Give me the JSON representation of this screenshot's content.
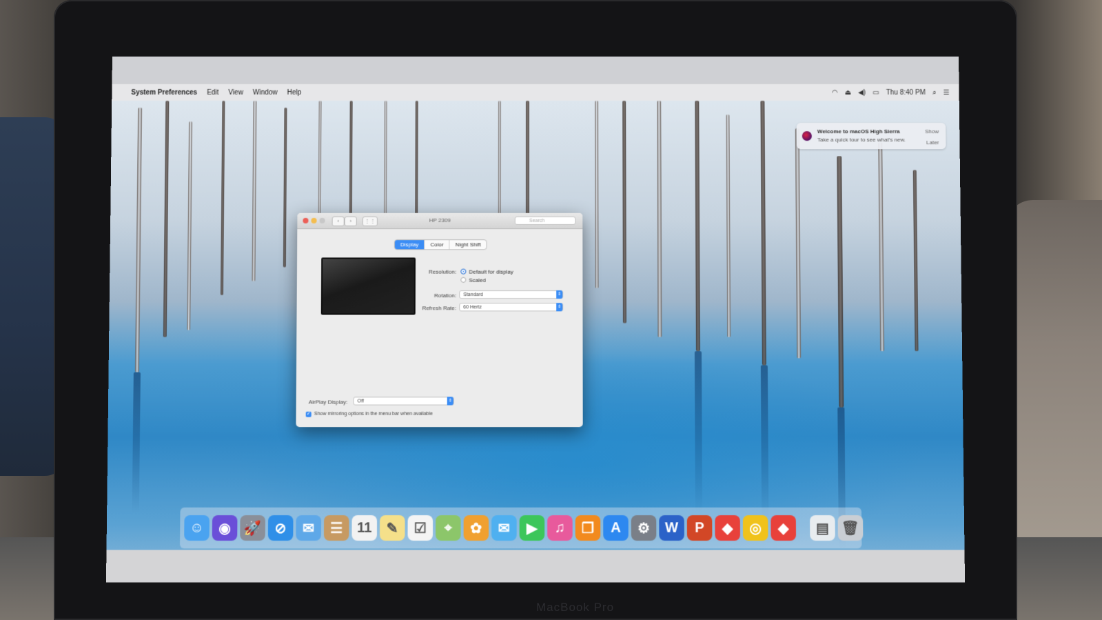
{
  "menubar": {
    "apple_icon": "",
    "app_name": "System Preferences",
    "menus": [
      "Edit",
      "View",
      "Window",
      "Help"
    ],
    "clock": "Thu 8:40 PM",
    "status_icons": [
      "wifi-icon",
      "volume-icon",
      "battery-icon",
      "search-icon",
      "list-icon"
    ]
  },
  "notification": {
    "title": "Welcome to macOS High Sierra",
    "body": "Take a quick tour to see what's new.",
    "show_label": "Show",
    "later_label": "Later"
  },
  "window": {
    "title": "HP 2309",
    "search_placeholder": "Search",
    "tabs": [
      "Display",
      "Color",
      "Night Shift"
    ],
    "active_tab": "Display",
    "resolution_label": "Resolution:",
    "resolution_options": [
      "Default for display",
      "Scaled"
    ],
    "resolution_selected": "Default for display",
    "rotation_label": "Rotation:",
    "rotation_value": "Standard",
    "refresh_label": "Refresh Rate:",
    "refresh_value": "60 Hertz",
    "airplay_label": "AirPlay Display:",
    "airplay_value": "Off",
    "mirroring_label": "Show mirroring options in the menu bar when available",
    "mirroring_checked": true
  },
  "dock": {
    "items": [
      {
        "name": "finder-icon",
        "glyph": "☺",
        "color": "#4aa3f0"
      },
      {
        "name": "siri-icon",
        "glyph": "◉",
        "color": "#6a4fd8"
      },
      {
        "name": "launchpad-icon",
        "glyph": "🚀",
        "color": "#8a8f99"
      },
      {
        "name": "safari-icon",
        "glyph": "⊘",
        "color": "#2f8fe8"
      },
      {
        "name": "mail-icon",
        "glyph": "✉",
        "color": "#5ea8e8"
      },
      {
        "name": "contacts-icon",
        "glyph": "☰",
        "color": "#c79a62"
      },
      {
        "name": "calendar-icon",
        "glyph": "11",
        "color": "#f2f2f2"
      },
      {
        "name": "notes-icon",
        "glyph": "✎",
        "color": "#f5e08a"
      },
      {
        "name": "reminders-icon",
        "glyph": "☑",
        "color": "#f4f4f4"
      },
      {
        "name": "maps-icon",
        "glyph": "⌖",
        "color": "#8cc66a"
      },
      {
        "name": "photos-icon",
        "glyph": "✿",
        "color": "#f0a030"
      },
      {
        "name": "messages-icon",
        "glyph": "✉",
        "color": "#4fb0f0"
      },
      {
        "name": "facetime-icon",
        "glyph": "▶",
        "color": "#3cc65a"
      },
      {
        "name": "itunes-icon",
        "glyph": "♫",
        "color": "#e85a9c"
      },
      {
        "name": "ibooks-icon",
        "glyph": "❒",
        "color": "#f28a1e"
      },
      {
        "name": "app-store-icon",
        "glyph": "A",
        "color": "#2d88f0"
      },
      {
        "name": "system-preferences-icon",
        "glyph": "⚙",
        "color": "#7a7f88"
      },
      {
        "name": "word-icon",
        "glyph": "W",
        "color": "#2b62c8"
      },
      {
        "name": "powerpoint-icon",
        "glyph": "P",
        "color": "#d24726"
      },
      {
        "name": "anydesk-icon",
        "glyph": "◆",
        "color": "#e8413b"
      },
      {
        "name": "chrome-icon",
        "glyph": "◎",
        "color": "#f0c21b"
      },
      {
        "name": "anydesk-2-icon",
        "glyph": "◆",
        "color": "#e8413b"
      },
      {
        "name": "document-icon",
        "glyph": "▤",
        "color": "#e8ecef"
      },
      {
        "name": "trash-icon",
        "glyph": "🗑",
        "color": "#c9ced4"
      }
    ]
  },
  "laptop": {
    "bezel_label": "MacBook Pro"
  }
}
